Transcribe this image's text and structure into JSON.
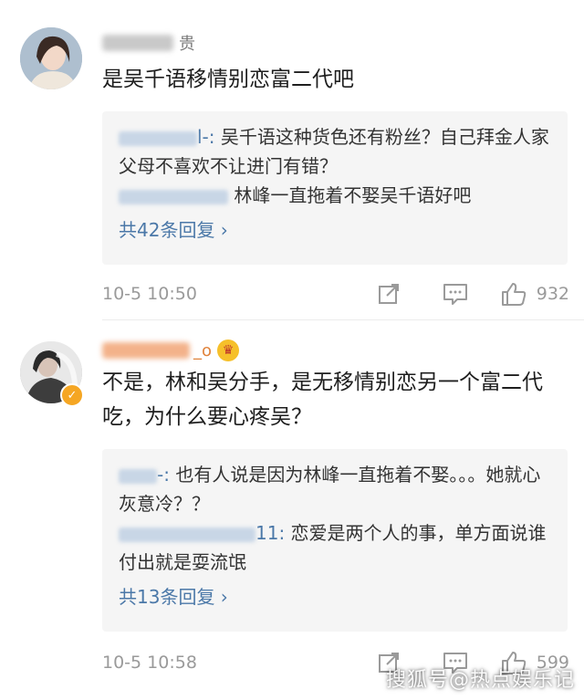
{
  "comments": [
    {
      "username_visible": "贵",
      "text": "是吴千语移情别恋富二代吧",
      "replies": [
        {
          "name_tail": "l-:",
          "text": "吴千语这种货色还有粉丝？自己拜金人家父母不喜欢不让进门有错？"
        },
        {
          "name_tail": "",
          "text": "林峰一直拖着不娶吴千语好吧"
        }
      ],
      "more_replies": "共42条回复 ›",
      "time": "10-5 10:50",
      "likes": "932"
    },
    {
      "username_visible": "_o",
      "text": "不是，林和吴分手，是无移情别恋另一个富二代吃，为什么要心疼吴？",
      "replies": [
        {
          "name_tail": "-:",
          "text": "也有人说是因为林峰一直拖着不娶。。。她就心灰意冷？？"
        },
        {
          "name_tail": "11:",
          "text": "恋爱是两个人的事，单方面说谁付出就是耍流氓"
        }
      ],
      "more_replies": "共13条回复 ›",
      "time": "10-5 10:58",
      "likes": "599"
    }
  ],
  "watermark": "搜狐号@热点娱乐记",
  "icons": {
    "share": "share-icon",
    "comment": "comment-icon",
    "like": "thumbs-up-icon",
    "verified": "verified-badge-icon",
    "crown": "vip-crown-icon"
  },
  "colors": {
    "link": "#4b78a8",
    "vip_name": "#e0823a",
    "meta": "#9a9a9a"
  }
}
